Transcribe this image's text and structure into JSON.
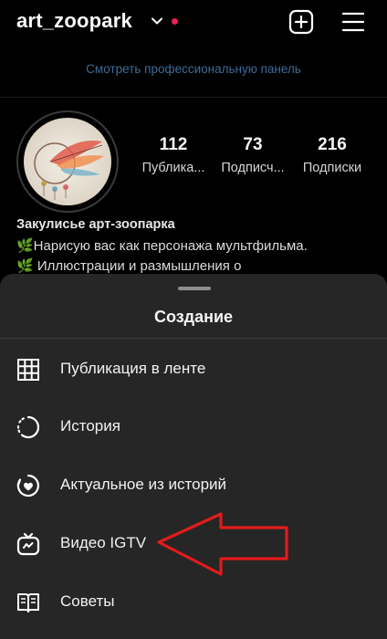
{
  "header": {
    "username": "art_zoopark",
    "icons": {
      "dropdown": "chevron-down-icon",
      "notification_dot": "notification-dot",
      "new_post": "plus-square-icon",
      "menu": "hamburger-menu-icon"
    },
    "accent_dot_color": "#ed1f55"
  },
  "professional_dashboard_link": "Смотреть профессиональную панель",
  "stats": [
    {
      "value": "112",
      "label": "Публика..."
    },
    {
      "value": "73",
      "label": "Подписч..."
    },
    {
      "value": "216",
      "label": "Подписки"
    }
  ],
  "bio": {
    "name": "Закулисье арт-зоопарка",
    "line1": "🌿Нарисую вас как персонажа мультфильма.",
    "line2": "🌿 Иллюстрации и размышления о"
  },
  "sheet": {
    "title": "Создание",
    "items": [
      {
        "label": "Публикация в ленте",
        "icon": "grid-icon"
      },
      {
        "label": "История",
        "icon": "story-circle-icon"
      },
      {
        "label": "Актуальное из историй",
        "icon": "highlight-heart-icon"
      },
      {
        "label": "Видео IGTV",
        "icon": "igtv-icon"
      },
      {
        "label": "Советы",
        "icon": "guide-book-icon"
      }
    ]
  },
  "annotation": {
    "arrow_color": "#e21b1b",
    "points_to": "Видео IGTV"
  }
}
